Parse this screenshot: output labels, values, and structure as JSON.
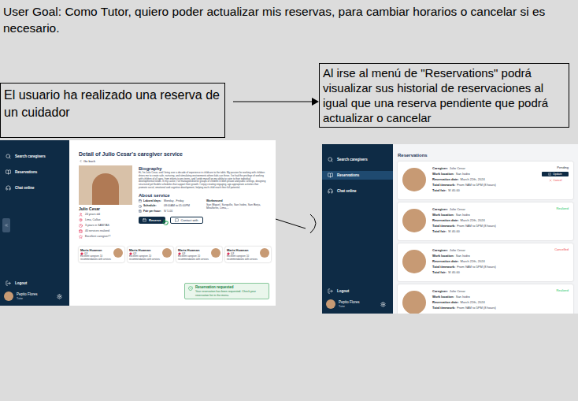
{
  "user_goal": "User Goal: Como Tutor, quiero poder actualizar mis reservas, para cambiar horarios o cancelar si es necesario.",
  "annotations": [
    {
      "text": "El usuario ha realizado una reserva de un cuidador"
    },
    {
      "text": "Al irse al menú de \"Reservations\" podrá visualizar sus historial de reservaciones al igual que una reserva pendiente que podrá actualizar o cancelar"
    }
  ],
  "detail_screen": {
    "sidebar": {
      "items": [
        {
          "label": "Search caregivers",
          "selected": false
        },
        {
          "label": "Reservations",
          "selected": false
        },
        {
          "label": "Chat online",
          "selected": false
        }
      ],
      "logout": "Logout",
      "user": {
        "name": "Pepito Flores",
        "role": "Tutor"
      }
    },
    "title": "Detail of Julio Cesar's caregiver service",
    "back": "Go back",
    "caregiver": {
      "name": "Julio Cesar",
      "facts": [
        "24 years old",
        "Lima, Callao",
        "3 years in SANITAS",
        "40 services realized",
        "Excellent caregiver!!!"
      ]
    },
    "biography": {
      "title": "Biography",
      "text": "Hi, I'm Julio Cesar, and I bring over a decade of experience in childcare to the table. My passion for working with children drives me to create safe, nurturing, and stimulating environments where kids can thrive. I've had the privilege of working with children of all ages, from infants to pre-teens, and I pride myself on my ability to cater to their individual developmental needs. In my career, I've managed diverse groups of children in both private and public settings, designing structured yet flexible schedules that support their growth. I enjoy creating engaging, age-appropriate activities that promote social, emotional and cognitive development, helping each child reach their full potential."
    },
    "about": {
      "title": "About service",
      "fields": [
        {
          "label": "Laboral days:",
          "value": "Monday - Friday"
        },
        {
          "label": "Schedule:",
          "value": "08:00AM to 05:00PM"
        },
        {
          "label": "Fair per hour:",
          "value": "S/ 5.00"
        }
      ],
      "workaround": {
        "label": "Workaround",
        "value": "San Miguel, Surquillo, San Isidro, San Borja, Miraflores, Lima,..."
      }
    },
    "buttons": {
      "reserve": "Reserve",
      "contact": "Contact with"
    },
    "similar": [
      {
        "name": "Maria Huaman",
        "rating": "4.8",
        "text": "Excellent caregiver, 10 recommendations with services"
      },
      {
        "name": "Maria Huaman",
        "rating": "4.8",
        "text": "Excellent caregiver, 10 recommendations with services"
      },
      {
        "name": "Maria Huaman",
        "rating": "4.8",
        "text": "Excellent caregiver, 10 recommendations with services"
      },
      {
        "name": "Maria Huaman",
        "rating": "4.8",
        "text": "Excellent caregiver, 10 recommendations with services"
      }
    ],
    "toast": {
      "title": "Reservation requested",
      "message": "Your reservation has been requested. Check your reservation list in the menu."
    }
  },
  "reservations_screen": {
    "sidebar": {
      "items": [
        {
          "label": "Search caregivers",
          "selected": false
        },
        {
          "label": "Reservations",
          "selected": true
        },
        {
          "label": "Chat online",
          "selected": false
        }
      ],
      "logout": "Logout",
      "user": {
        "name": "Pepito Flores",
        "role": "Tutor"
      }
    },
    "title": "Reservations",
    "items": [
      {
        "status": "Pending",
        "color": "#1f2937",
        "fields": [
          {
            "label": "Caregiver:",
            "value": "Julio Cesar"
          },
          {
            "label": "Work location:",
            "value": "San Isidro"
          },
          {
            "label": "Reservation date:",
            "value": "March 22th, 2024"
          },
          {
            "label": "Total timework:",
            "value": "From 9AM to 5PM (8 hours)"
          },
          {
            "label": "Total fair:",
            "value": "S/ 40.00"
          }
        ],
        "actions": [
          {
            "label": "Update",
            "kind": "primary"
          },
          {
            "label": "Cancel",
            "kind": "danger"
          }
        ]
      },
      {
        "status": "Realized",
        "color": "#22c55e",
        "fields": [
          {
            "label": "Caregiver:",
            "value": "Julio Cesar"
          },
          {
            "label": "Work location:",
            "value": "San Isidro"
          },
          {
            "label": "Reservation date:",
            "value": "March 22th, 2024"
          },
          {
            "label": "Total timework:",
            "value": "From 9AM to 5PM (8 hours)"
          },
          {
            "label": "Total fair:",
            "value": "S/ 40.00"
          }
        ],
        "actions": []
      },
      {
        "status": "Cancelled",
        "color": "#ef4444",
        "fields": [
          {
            "label": "Caregiver:",
            "value": "Julio Cesar"
          },
          {
            "label": "Work location:",
            "value": "San Isidro"
          },
          {
            "label": "Reservation date:",
            "value": "March 22th, 2024"
          },
          {
            "label": "Total timework:",
            "value": "From 9AM to 5PM (8 hours)"
          },
          {
            "label": "Total fair:",
            "value": "S/ 40.00"
          }
        ],
        "actions": []
      },
      {
        "status": "Realized",
        "color": "#22c55e",
        "fields": [
          {
            "label": "Caregiver:",
            "value": "Julio Cesar"
          },
          {
            "label": "Work location:",
            "value": "San Isidro"
          },
          {
            "label": "Reservation date:",
            "value": "March 22th, 2024"
          },
          {
            "label": "Total timework:",
            "value": "From 9AM to 5PM (8 hours)"
          }
        ],
        "actions": []
      }
    ]
  }
}
